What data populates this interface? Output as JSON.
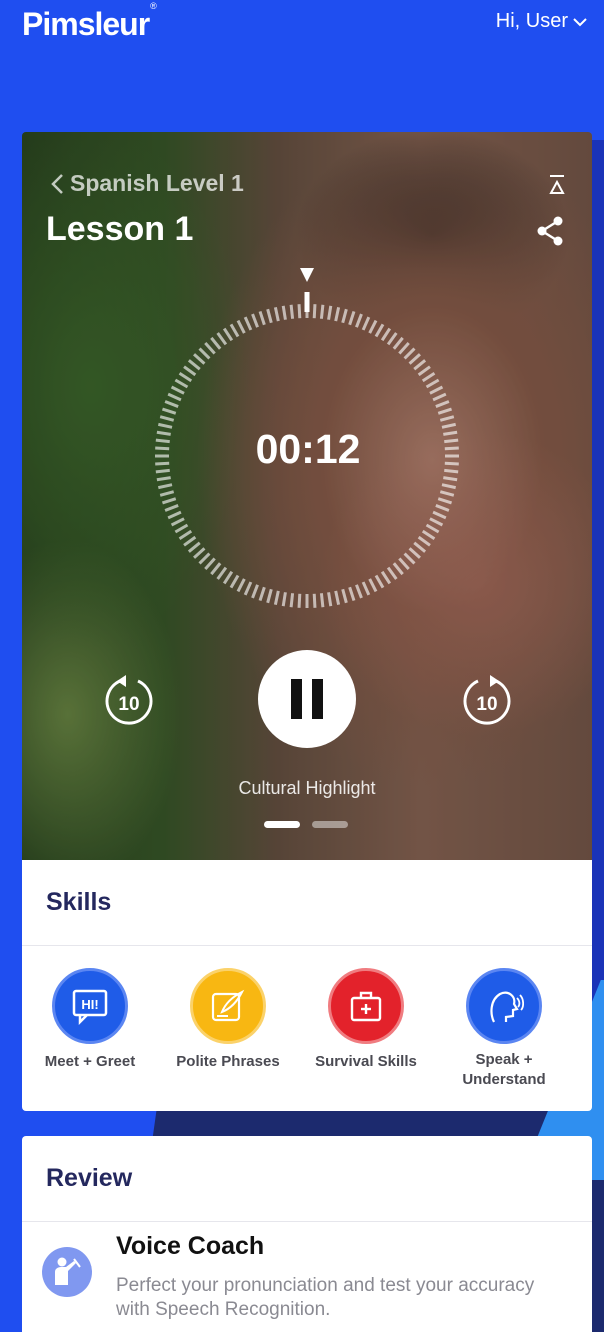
{
  "header": {
    "brand": "Pimsleur",
    "trademark": "®",
    "user_greeting": "Hi, User"
  },
  "lesson": {
    "course_link": "Spanish Level 1",
    "title": "Lesson 1",
    "timer": "00:12",
    "skip_back_label": "10",
    "skip_forward_label": "10",
    "segment_label": "Cultural Highlight",
    "progress_fraction": 0.0
  },
  "skills": {
    "title": "Skills",
    "items": [
      {
        "label": "Meet + Greet",
        "icon": "speech-bubble-hi-icon",
        "color": "#1f5ce8",
        "ring": "#5b86f2"
      },
      {
        "label": "Polite Phrases",
        "icon": "quill-icon",
        "color": "#f8b712",
        "ring": "#fbd26a"
      },
      {
        "label": "Survival Skills",
        "icon": "first-aid-kit-icon",
        "color": "#e3222b",
        "ring": "#f07c80"
      },
      {
        "label": "Speak + Understand",
        "icon": "head-speaking-icon",
        "color": "#1f5ce8",
        "ring": "#5b86f2"
      }
    ]
  },
  "review": {
    "title": "Review",
    "voice_coach_title": "Voice Coach",
    "voice_coach_desc": "Perfect your pronunciation and test your accuracy with Speech Recognition."
  },
  "colors": {
    "brand_blue": "#1f4ef0",
    "heading_navy": "#24285e"
  }
}
